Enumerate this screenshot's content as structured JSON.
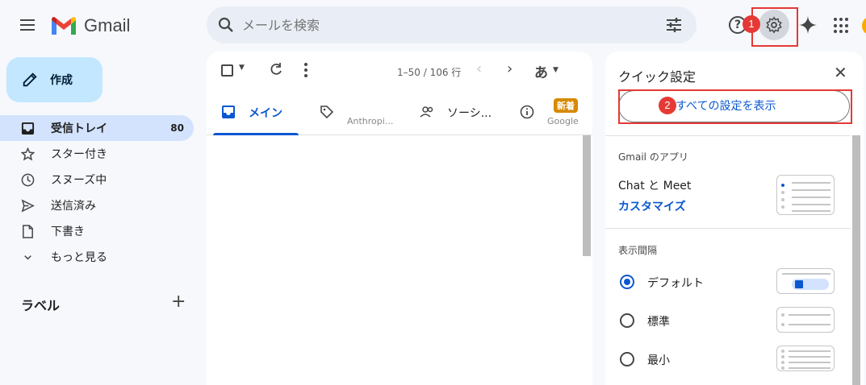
{
  "header": {
    "brand": "Gmail",
    "search_placeholder": "メールを検索",
    "icons": [
      "menu-icon",
      "search-icon",
      "tune-icon",
      "help-icon",
      "gear-icon",
      "gemini-sparkle-icon",
      "apps-icon"
    ]
  },
  "annotations": {
    "step1": "1",
    "step2": "2"
  },
  "sidebar": {
    "compose_label": "作成",
    "items": [
      {
        "label": "受信トレイ",
        "count": "80",
        "icon": "inbox-icon"
      },
      {
        "label": "スター付き",
        "icon": "star-icon"
      },
      {
        "label": "スヌーズ中",
        "icon": "clock-icon"
      },
      {
        "label": "送信済み",
        "icon": "send-icon"
      },
      {
        "label": "下書き",
        "icon": "draft-icon"
      },
      {
        "label": "もっと見る",
        "icon": "chevron-down-icon"
      }
    ],
    "labels_header": "ラベル",
    "labels_add": "+"
  },
  "toolbar": {
    "pagination": "1–50 / 106 行",
    "input_tool": "あ"
  },
  "tabs": [
    {
      "label": "メイン",
      "icon": "inbox-tab-icon"
    },
    {
      "sub": "Anthropi...",
      "icon": "tag-icon"
    },
    {
      "label": "ソーシ...",
      "icon": "people-icon"
    },
    {
      "badge": "新着",
      "sub": "Google",
      "icon": "info-icon"
    }
  ],
  "quick_settings": {
    "title": "クイック設定",
    "close": "✕",
    "all_settings": "すべての設定を表示",
    "apps_section": "Gmail のアプリ",
    "chat_meet": "Chat と Meet",
    "customize": "カスタマイズ",
    "density_section": "表示間隔",
    "density_options": [
      {
        "label": "デフォルト",
        "selected": true
      },
      {
        "label": "標準",
        "selected": false
      },
      {
        "label": "最小",
        "selected": false
      }
    ]
  },
  "colors": {
    "accent": "#0b57d0",
    "compose": "#c2e7ff",
    "active_nav": "#d3e3fd",
    "annotation_red": "#e53935"
  }
}
